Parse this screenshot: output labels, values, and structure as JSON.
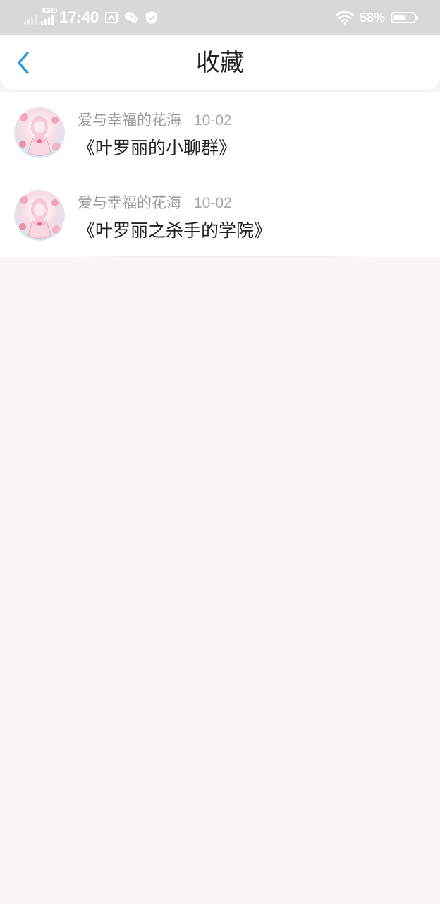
{
  "status_bar": {
    "network": "4GHD",
    "time": "17:40",
    "battery_percent": "58%",
    "battery_level": 0.58,
    "icons": [
      "signal-icon",
      "network-4g-icon",
      "screenshot-icon",
      "wechat-icon",
      "shield-icon",
      "wifi-icon",
      "battery-icon"
    ]
  },
  "header": {
    "title": "收藏",
    "back_icon": "chevron-left-icon",
    "accent_color": "#2f9be0"
  },
  "items": [
    {
      "author": "爱与幸福的花海",
      "date": "10-02",
      "title": "《叶罗丽的小聊群》",
      "avatar": "avatar-image"
    },
    {
      "author": "爱与幸福的花海",
      "date": "10-02",
      "title": "《叶罗丽之杀手的学院》",
      "avatar": "avatar-image"
    }
  ]
}
